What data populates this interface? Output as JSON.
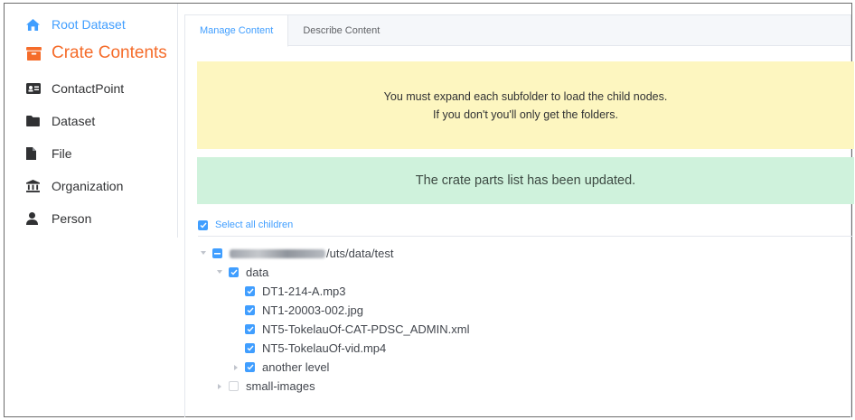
{
  "sidebar": {
    "items": [
      {
        "label": "Root Dataset",
        "icon": "home-icon"
      },
      {
        "label": "Crate Contents",
        "icon": "archive-box-icon"
      },
      {
        "label": "ContactPoint",
        "icon": "id-card-icon"
      },
      {
        "label": "Dataset",
        "icon": "folder-icon"
      },
      {
        "label": "File",
        "icon": "file-icon"
      },
      {
        "label": "Organization",
        "icon": "institution-icon"
      },
      {
        "label": "Person",
        "icon": "user-icon"
      }
    ]
  },
  "tabs": [
    {
      "label": "Manage Content"
    },
    {
      "label": "Describe Content"
    }
  ],
  "alerts": {
    "warning_line1": "You must expand each subfolder to load the child nodes.",
    "warning_line2": "If you don't you'll only get the folders.",
    "success": "The crate parts list has been updated."
  },
  "select_all_label": "Select all children",
  "tree": {
    "root_suffix": "/uts/data/test",
    "data_folder": "data",
    "files": [
      "DT1-214-A.mp3",
      "NT1-20003-002.jpg",
      "NT5-TokelauOf-CAT-PDSC_ADMIN.xml",
      "NT5-TokelauOf-vid.mp4"
    ],
    "another_level": "another level",
    "small_images": "small-images"
  },
  "colors": {
    "accent": "#409eff",
    "active_nav": "#f56c2a",
    "warning_bg": "#fdf6c0",
    "success_bg": "#cff2dc"
  }
}
